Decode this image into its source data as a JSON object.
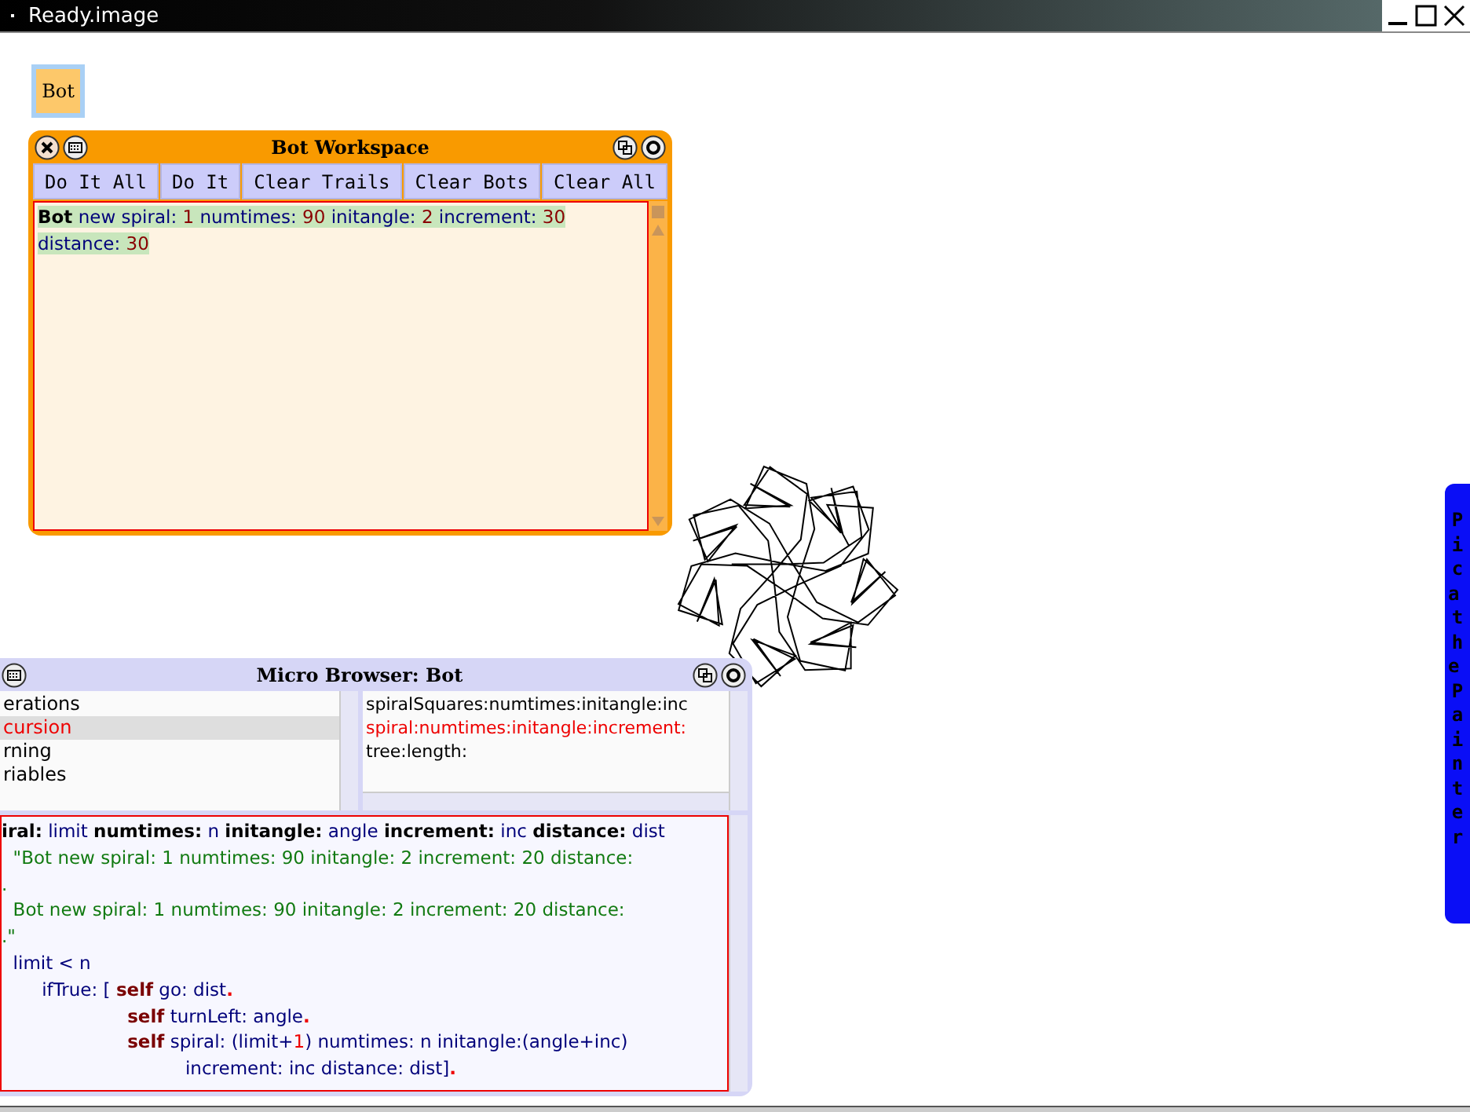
{
  "window": {
    "title": "Ready.image"
  },
  "desktop_button": {
    "label": "Bot"
  },
  "workspace": {
    "title": "Bot Workspace",
    "buttons": [
      "Do It All",
      "Do It",
      "Clear Trails",
      "Clear Bots",
      "Clear All"
    ],
    "code_lines": [
      [
        {
          "kind": "class",
          "text": "Bot"
        },
        {
          "kind": "plain",
          "text": " new spiral: "
        },
        {
          "kind": "number",
          "text": "1"
        },
        {
          "kind": "plain",
          "text": " numtimes: "
        },
        {
          "kind": "number",
          "text": "90"
        },
        {
          "kind": "plain",
          "text": " initangle: "
        },
        {
          "kind": "number",
          "text": "2"
        },
        {
          "kind": "plain",
          "text": " increment: "
        },
        {
          "kind": "number",
          "text": "30"
        }
      ],
      [
        {
          "kind": "plain",
          "text": "distance: "
        },
        {
          "kind": "number",
          "text": "30"
        }
      ]
    ]
  },
  "browser": {
    "title": "Micro Browser: Bot",
    "categories": [
      {
        "label": "erations",
        "selected": false
      },
      {
        "label": "cursion",
        "selected": true
      },
      {
        "label": "rning",
        "selected": false
      },
      {
        "label": "riables",
        "selected": false
      }
    ],
    "methods": [
      {
        "label": "spiralSquares:numtimes:initangle:inc",
        "selected": false
      },
      {
        "label": "spiral:numtimes:initangle:increment:",
        "selected": true
      },
      {
        "label": "tree:length:",
        "selected": false
      }
    ],
    "code_lines": [
      [
        {
          "kind": "selector",
          "text": "iral:"
        },
        {
          "kind": "plain",
          "text": " limit "
        },
        {
          "kind": "selector",
          "text": "numtimes:"
        },
        {
          "kind": "plain",
          "text": " n "
        },
        {
          "kind": "selector",
          "text": "initangle:"
        },
        {
          "kind": "plain",
          "text": " angle "
        },
        {
          "kind": "selector",
          "text": "increment:"
        },
        {
          "kind": "plain",
          "text": " inc "
        },
        {
          "kind": "selector",
          "text": "distance:"
        },
        {
          "kind": "plain",
          "text": " dist"
        }
      ],
      [
        {
          "kind": "comment",
          "text": "  \"Bot new spiral: 1 numtimes: 90 initangle: 2 increment: 20 distance:"
        }
      ],
      [
        {
          "kind": "comment",
          "text": "."
        }
      ],
      [
        {
          "kind": "comment",
          "text": "  Bot new spiral: 1 numtimes: 90 initangle: 2 increment: 20 distance:"
        }
      ],
      [
        {
          "kind": "comment",
          "text": ".\""
        }
      ],
      [
        {
          "kind": "plain",
          "text": "  limit < n"
        }
      ],
      [
        {
          "kind": "plain",
          "text": "       ifTrue: [ "
        },
        {
          "kind": "self",
          "text": "self"
        },
        {
          "kind": "plain",
          "text": " go: dist"
        },
        {
          "kind": "period",
          "text": "."
        }
      ],
      [
        {
          "kind": "self",
          "text": "                    self"
        },
        {
          "kind": "plain",
          "text": " turnLeft: angle"
        },
        {
          "kind": "period",
          "text": "."
        }
      ],
      [
        {
          "kind": "self",
          "text": "                    self"
        },
        {
          "kind": "plain",
          "text": " spiral: (limit+"
        },
        {
          "kind": "number",
          "text": "1"
        },
        {
          "kind": "plain",
          "text": ") numtimes: n initangle:(angle+inc)"
        }
      ],
      [
        {
          "kind": "plain",
          "text": "                                increment: inc distance: dist]"
        },
        {
          "kind": "period",
          "text": "."
        }
      ]
    ]
  },
  "flap": {
    "label": "Pica the Painter"
  }
}
